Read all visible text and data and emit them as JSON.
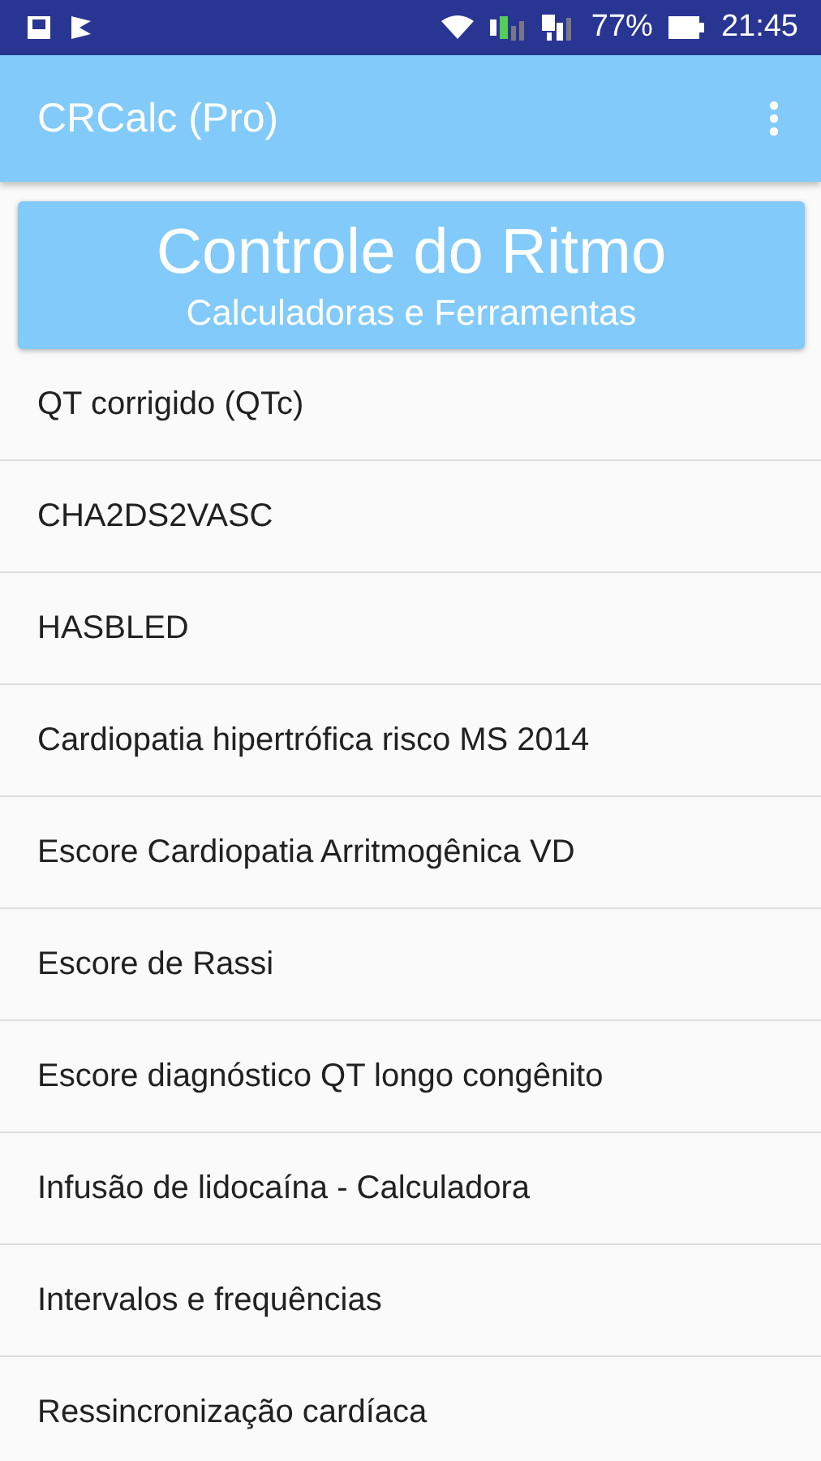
{
  "status_bar": {
    "battery": "77%",
    "time": "21:45"
  },
  "app_bar": {
    "title": "CRCalc (Pro)"
  },
  "banner": {
    "title": "Controle do Ritmo",
    "subtitle": "Calculadoras e Ferramentas"
  },
  "items": [
    {
      "label": "QT corrigido (QTc)"
    },
    {
      "label": "CHA2DS2VASC"
    },
    {
      "label": "HASBLED"
    },
    {
      "label": "Cardiopatia hipertrófica risco MS 2014"
    },
    {
      "label": "Escore Cardiopatia Arritmogênica VD"
    },
    {
      "label": "Escore de Rassi"
    },
    {
      "label": "Escore diagnóstico QT longo congênito"
    },
    {
      "label": "Infusão de lidocaína - Calculadora"
    },
    {
      "label": "Intervalos e frequências"
    },
    {
      "label": "Ressincronização cardíaca"
    }
  ]
}
